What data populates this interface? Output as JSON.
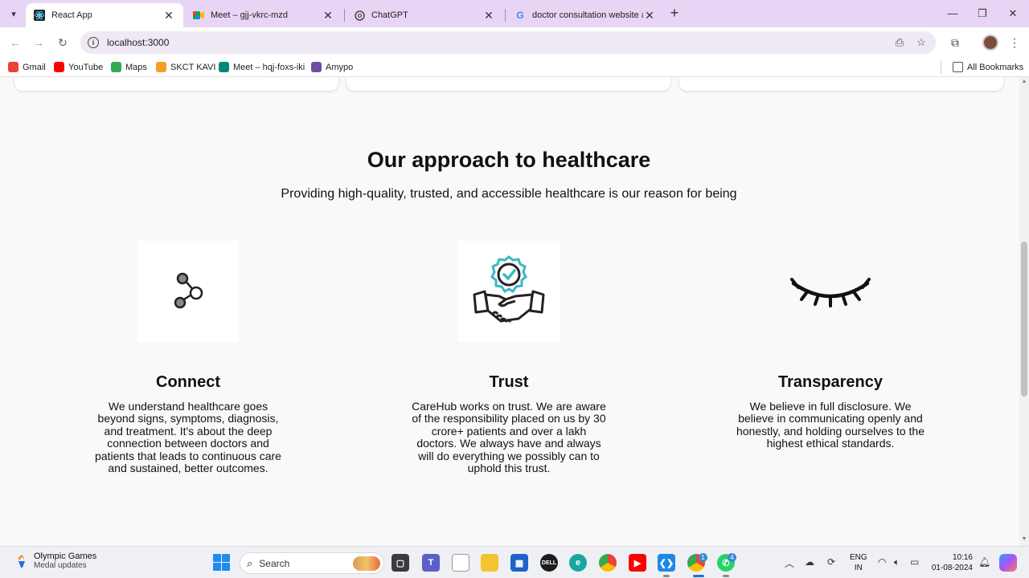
{
  "browser": {
    "tabs": [
      {
        "title": "React App",
        "active": true,
        "favicon": "react-icon"
      },
      {
        "title": "Meet – gjj-vkrc-mzd",
        "active": false,
        "favicon": "meet-icon"
      },
      {
        "title": "ChatGPT",
        "active": false,
        "favicon": "chatgpt-icon"
      },
      {
        "title": "doctor consultation website as",
        "active": false,
        "favicon": "google-icon"
      }
    ],
    "url": "localhost:3000",
    "bookmarks": [
      {
        "label": "Gmail",
        "icon": "gmail-icon",
        "color": "#ea4335"
      },
      {
        "label": "YouTube",
        "icon": "youtube-icon",
        "color": "#ff0000"
      },
      {
        "label": "Maps",
        "icon": "maps-icon",
        "color": "#34a853"
      },
      {
        "label": "SKCT KAVI",
        "icon": "skct-icon",
        "color": "#f4a020"
      },
      {
        "label": "Meet – hqj-foxs-iki",
        "icon": "meet-icon",
        "color": "#00897b"
      },
      {
        "label": "Amypo",
        "icon": "amypo-icon",
        "color": "#6b4fa0"
      }
    ],
    "all_bookmarks_label": "All Bookmarks"
  },
  "page": {
    "heading": "Our approach to healthcare",
    "subheading": "Providing high-quality, trusted, and accessible healthcare is our reason for being",
    "pillars": [
      {
        "title": "Connect",
        "icon": "network-nodes-icon",
        "text": "We understand healthcare goes beyond signs, symptoms, diagnosis, and treatment. It's about the deep connection between doctors and patients that leads to continuous care and sustained, better outcomes."
      },
      {
        "title": "Trust",
        "icon": "handshake-badge-icon",
        "text": "CareHub works on trust. We are aware of the responsibility placed on us by 30 crore+ patients and over a lakh doctors. We always have and always will do everything we possibly can to uphold this trust."
      },
      {
        "title": "Transparency",
        "icon": "eyelash-icon",
        "text": "We believe in full disclosure. We believe in communicating openly and honestly, and holding ourselves to the highest ethical standards."
      }
    ]
  },
  "taskbar": {
    "weather_title": "Olympic Games",
    "weather_sub": "Medal updates",
    "search_label": "Search",
    "lang_line1": "ENG",
    "lang_line2": "IN",
    "time": "10:16",
    "date": "01-08-2024",
    "chrome_badge": "1",
    "whatsapp_badge": "4"
  },
  "colors": {
    "tabstrip": "#e8d5f5",
    "accent_teal": "#3bb8c4",
    "page_bg": "#f9f9f9"
  }
}
